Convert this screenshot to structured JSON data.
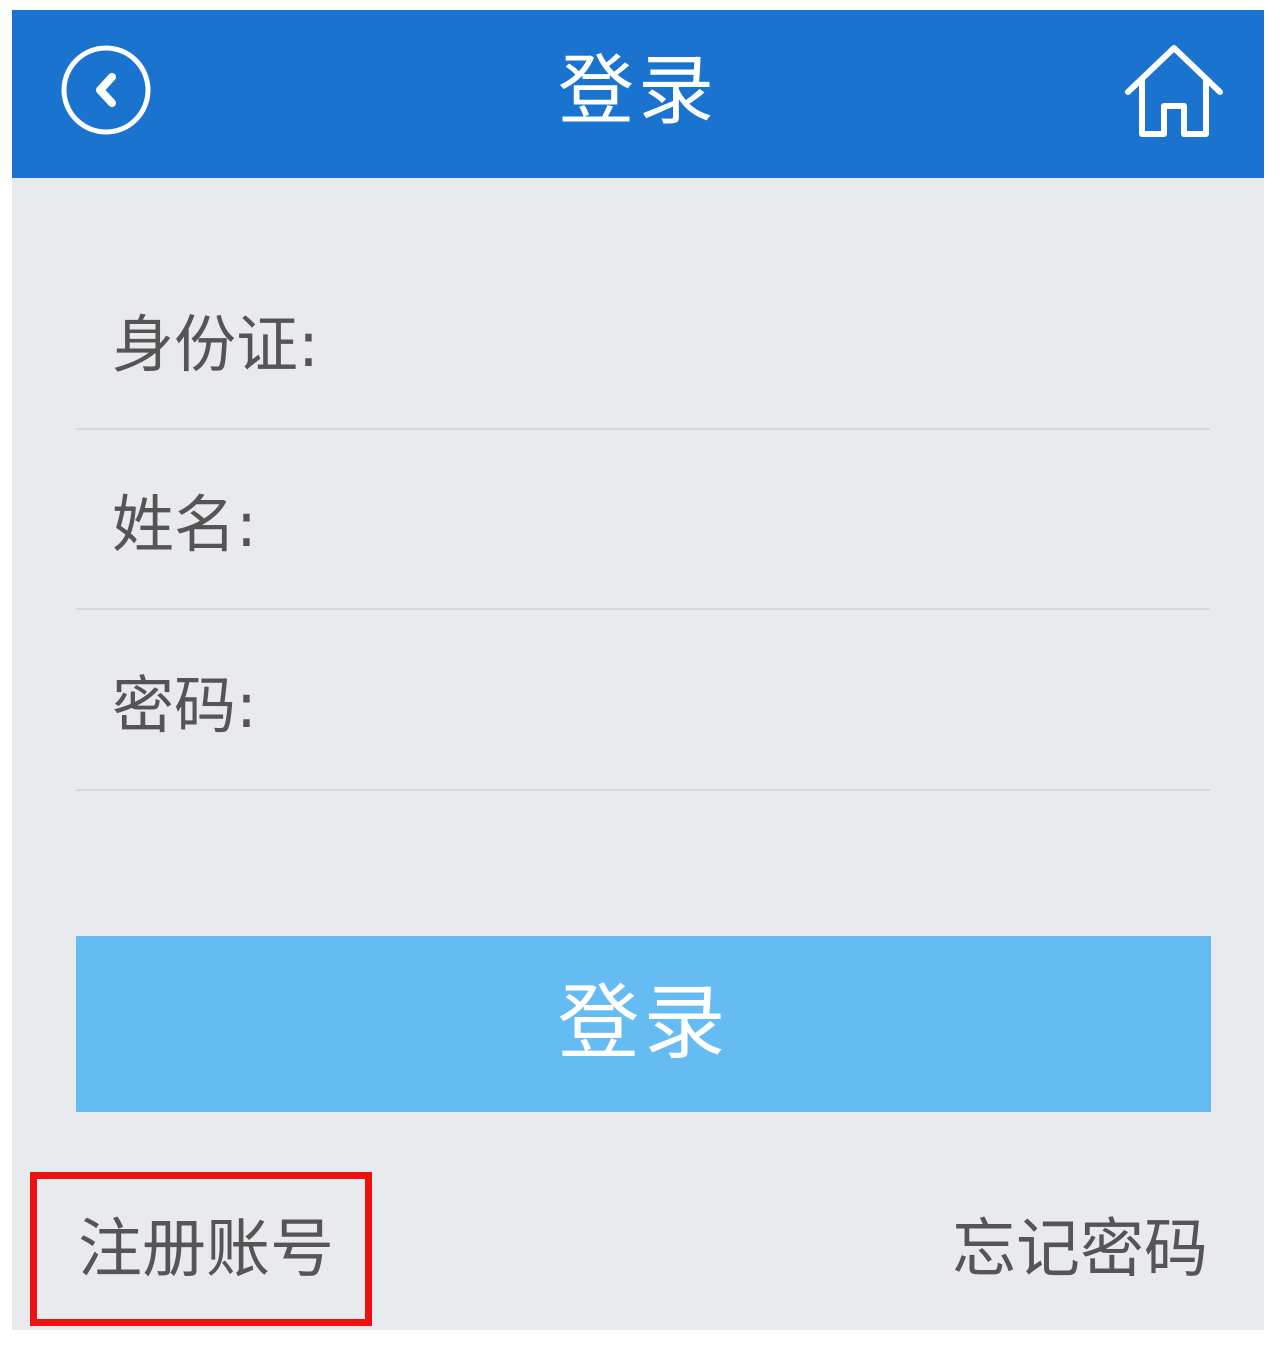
{
  "header": {
    "title": "登录",
    "back_icon": "chevron-left-circle-icon",
    "home_icon": "home-icon"
  },
  "form": {
    "fields": [
      {
        "label": "身份证:",
        "value": ""
      },
      {
        "label": "姓名:",
        "value": ""
      },
      {
        "label": "密码:",
        "value": ""
      }
    ],
    "submit_label": "登录"
  },
  "footer": {
    "register_label": "注册账号",
    "forgot_label": "忘记密码"
  },
  "colors": {
    "navbar": "#1a74cf",
    "button": "#65bcf2",
    "background": "#e9eaee",
    "highlight": "#ee1111"
  }
}
